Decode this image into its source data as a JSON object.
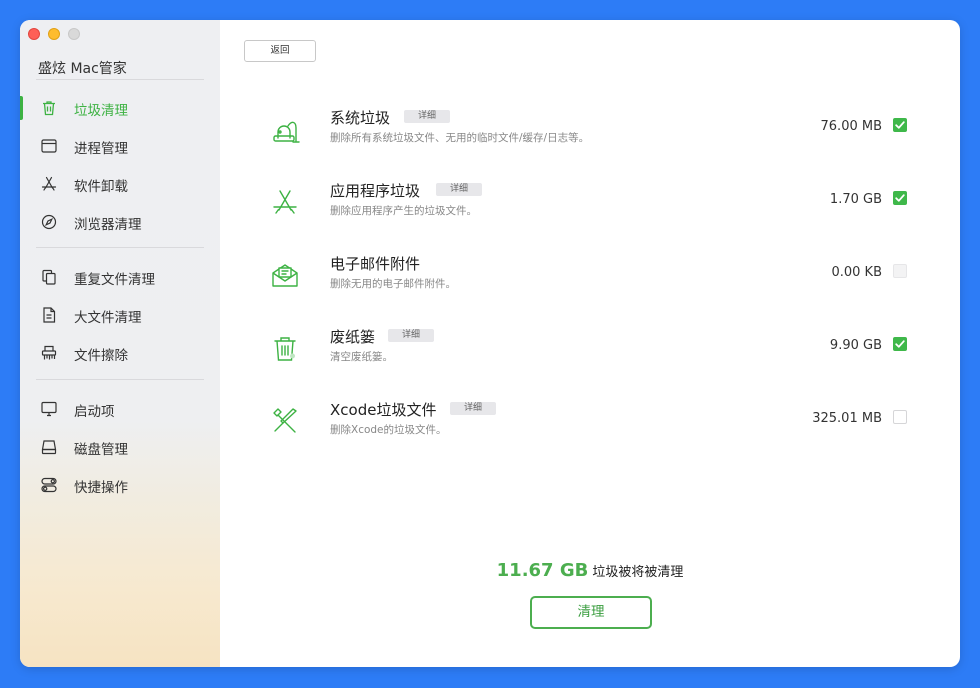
{
  "app": {
    "title": "盛炫 Mac管家"
  },
  "sidebar": {
    "groups": [
      [
        {
          "label": "垃圾清理",
          "icon": "trash-icon",
          "active": true
        },
        {
          "label": "进程管理",
          "icon": "window-icon"
        },
        {
          "label": "软件卸载",
          "icon": "app-store-icon"
        },
        {
          "label": "浏览器清理",
          "icon": "compass-icon"
        }
      ],
      [
        {
          "label": "重复文件清理",
          "icon": "duplicate-files-icon"
        },
        {
          "label": "大文件清理",
          "icon": "document-icon"
        },
        {
          "label": "文件擦除",
          "icon": "shredder-icon"
        }
      ],
      [
        {
          "label": "启动项",
          "icon": "monitor-icon"
        },
        {
          "label": "磁盘管理",
          "icon": "disk-icon"
        },
        {
          "label": "快捷操作",
          "icon": "toggles-icon"
        }
      ]
    ]
  },
  "toolbar": {
    "back_label": "返回"
  },
  "items": [
    {
      "title": "系统垃圾",
      "detail": "详细",
      "desc": "删除所有系统垃圾文件、无用的临时文件/缓存/日志等。",
      "size": "76.00 MB",
      "checked": true,
      "icon": "vacuum-cleaner-icon"
    },
    {
      "title": "应用程序垃圾",
      "detail": "详细",
      "desc": "删除应用程序产生的垃圾文件。",
      "size": "1.70 GB",
      "checked": true,
      "icon": "app-store-icon"
    },
    {
      "title": "电子邮件附件",
      "detail": "",
      "desc": "删除无用的电子邮件附件。",
      "size": "0.00 KB",
      "checked": false,
      "disabled": true,
      "icon": "mail-icon"
    },
    {
      "title": "废纸篓",
      "detail": "详细",
      "desc": "清空废纸篓。",
      "size": "9.90 GB",
      "checked": true,
      "icon": "trash-bin-icon"
    },
    {
      "title": "Xcode垃圾文件",
      "detail": "详细",
      "desc": "删除Xcode的垃圾文件。",
      "size": "325.01 MB",
      "checked": false,
      "icon": "hammer-icon"
    }
  ],
  "summary": {
    "total": "11.67 GB",
    "text": "垃圾被将被清理"
  },
  "actions": {
    "clean_label": "清理"
  },
  "colors": {
    "accent": "#3db243",
    "background": "#2d7cf6"
  }
}
